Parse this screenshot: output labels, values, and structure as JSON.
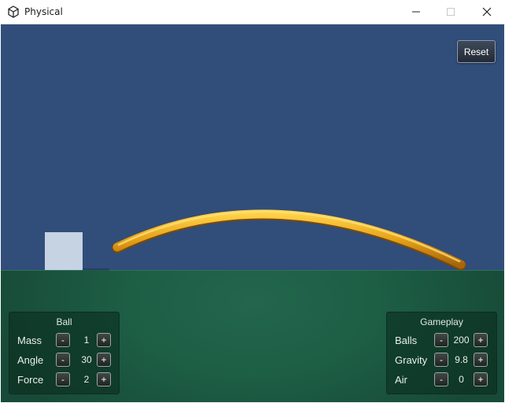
{
  "window": {
    "title": "Physical",
    "controls": [
      "minimize",
      "maximize",
      "close"
    ]
  },
  "reset_label": "Reset",
  "ball_panel": {
    "title": "Ball",
    "rows": [
      {
        "label": "Mass",
        "value": "1"
      },
      {
        "label": "Angle",
        "value": "30"
      },
      {
        "label": "Force",
        "value": "2"
      }
    ]
  },
  "gameplay_panel": {
    "title": "Gameplay",
    "rows": [
      {
        "label": "Balls",
        "value": "200"
      },
      {
        "label": "Gravity",
        "value": "9.8"
      },
      {
        "label": "Air",
        "value": "0"
      }
    ]
  },
  "buttons": {
    "minus": "-",
    "plus": "+"
  },
  "colors": {
    "sky": "#314d7a",
    "ground": "#1d5f45",
    "block": "#c5d3e3",
    "trail": "#e6a41c"
  },
  "icons": {
    "app": "unity-logo-icon",
    "minimize": "minimize-icon",
    "maximize": "maximize-icon",
    "close": "close-icon"
  }
}
